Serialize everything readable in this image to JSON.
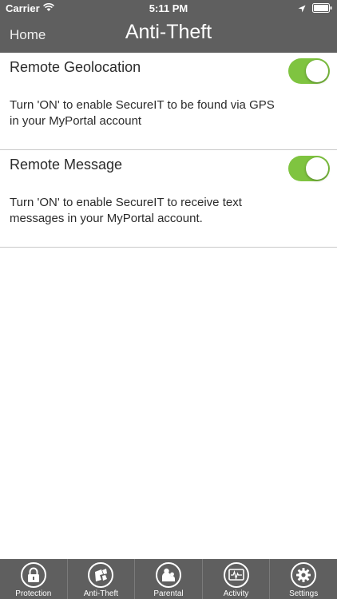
{
  "status_bar": {
    "carrier": "Carrier",
    "time": "5:11 PM"
  },
  "nav": {
    "back_label": "Home",
    "title": "Anti-Theft"
  },
  "settings": [
    {
      "title": "Remote Geolocation",
      "description": "Turn 'ON' to enable SecureIT to be found via GPS in your MyPortal account",
      "enabled": true
    },
    {
      "title": "Remote Message",
      "description": "Turn 'ON' to enable SecureIT to receive text messages in your MyPortal account.",
      "enabled": true
    }
  ],
  "tabs": [
    {
      "label": "Protection",
      "icon": "lock-icon"
    },
    {
      "label": "Anti-Theft",
      "icon": "broken-phone-icon"
    },
    {
      "label": "Parental",
      "icon": "parent-child-icon"
    },
    {
      "label": "Activity",
      "icon": "activity-monitor-icon"
    },
    {
      "label": "Settings",
      "icon": "gear-icon"
    }
  ],
  "colors": {
    "bar_background": "#5f5f5f",
    "toggle_on": "#7fc440",
    "divider": "#c9c9c9"
  }
}
